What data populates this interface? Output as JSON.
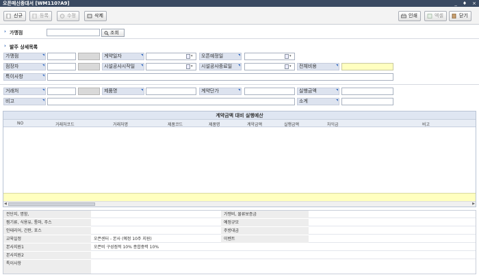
{
  "window": {
    "title": "오픈매신종대서 [WM110?A9]",
    "controls": [
      "_",
      "♦",
      "×"
    ]
  },
  "toolbar": {
    "new_label": "신규",
    "register_label": "등록",
    "edit_label": "수정",
    "delete_label": "삭제",
    "print_label": "인쇄",
    "excel_label": "엑셀",
    "close_label": "닫기"
  },
  "search": {
    "store_label": "가맹점",
    "store_value": "",
    "search_button_label": "조회"
  },
  "order_section": {
    "title": "발주 상세목록",
    "fields": {
      "store_label": "가맹점",
      "contract_date_label": "계약일자",
      "open_date_label": "오픈예정일",
      "owner_label": "점장자",
      "construction_start_label": "시설공사시작일",
      "construction_end_label": "시설공사종료일",
      "total_amount_label": "전체비용",
      "notes_label": "특이사항"
    }
  },
  "item_section": {
    "fields": {
      "vendor_label": "거래처",
      "product_label": "제품명",
      "unit_price_label": "계약단가",
      "contract_amount_label": "실행금액",
      "remarks_label": "비고",
      "subtotal_label": "소계"
    }
  },
  "grid": {
    "title": "계약금액 대비 실행예산",
    "columns": [
      "NO",
      "거래처코드",
      "거래처명",
      "제품코드",
      "제품명",
      "계약금액",
      "실행금액",
      "차익금",
      "비고"
    ]
  },
  "info": {
    "rows": [
      {
        "label": "전단지, 명함,",
        "value": "",
        "label2": "가맹비, 물류보증금",
        "value2": ""
      },
      {
        "label": "찜기류, 식용유, 통마, 주스",
        "value": "",
        "label2": "예정규모",
        "value2": ""
      },
      {
        "label": "인테리어, 간판, 포스",
        "value": "",
        "label2": "주방대금",
        "value2": ""
      },
      {
        "label": "교육일정",
        "value": "오픈센터 - 본사 (예정 10주 지원)",
        "label2": "이벤트",
        "value2": ""
      },
      {
        "label": "본사지원1",
        "value": "오픈비 구성점적 10% 종합중력 10%",
        "label2": "",
        "value2": ""
      },
      {
        "label": "본사지원2",
        "value": "",
        "label2": "",
        "value2": ""
      },
      {
        "label": "특이사항",
        "value": "",
        "label2": "",
        "value2": ""
      }
    ]
  },
  "colors": {
    "titlebar": "#3a4a62",
    "label_bg": "#dde3ef",
    "highlight": "#ffffc0",
    "accent": "#2d63b8"
  }
}
